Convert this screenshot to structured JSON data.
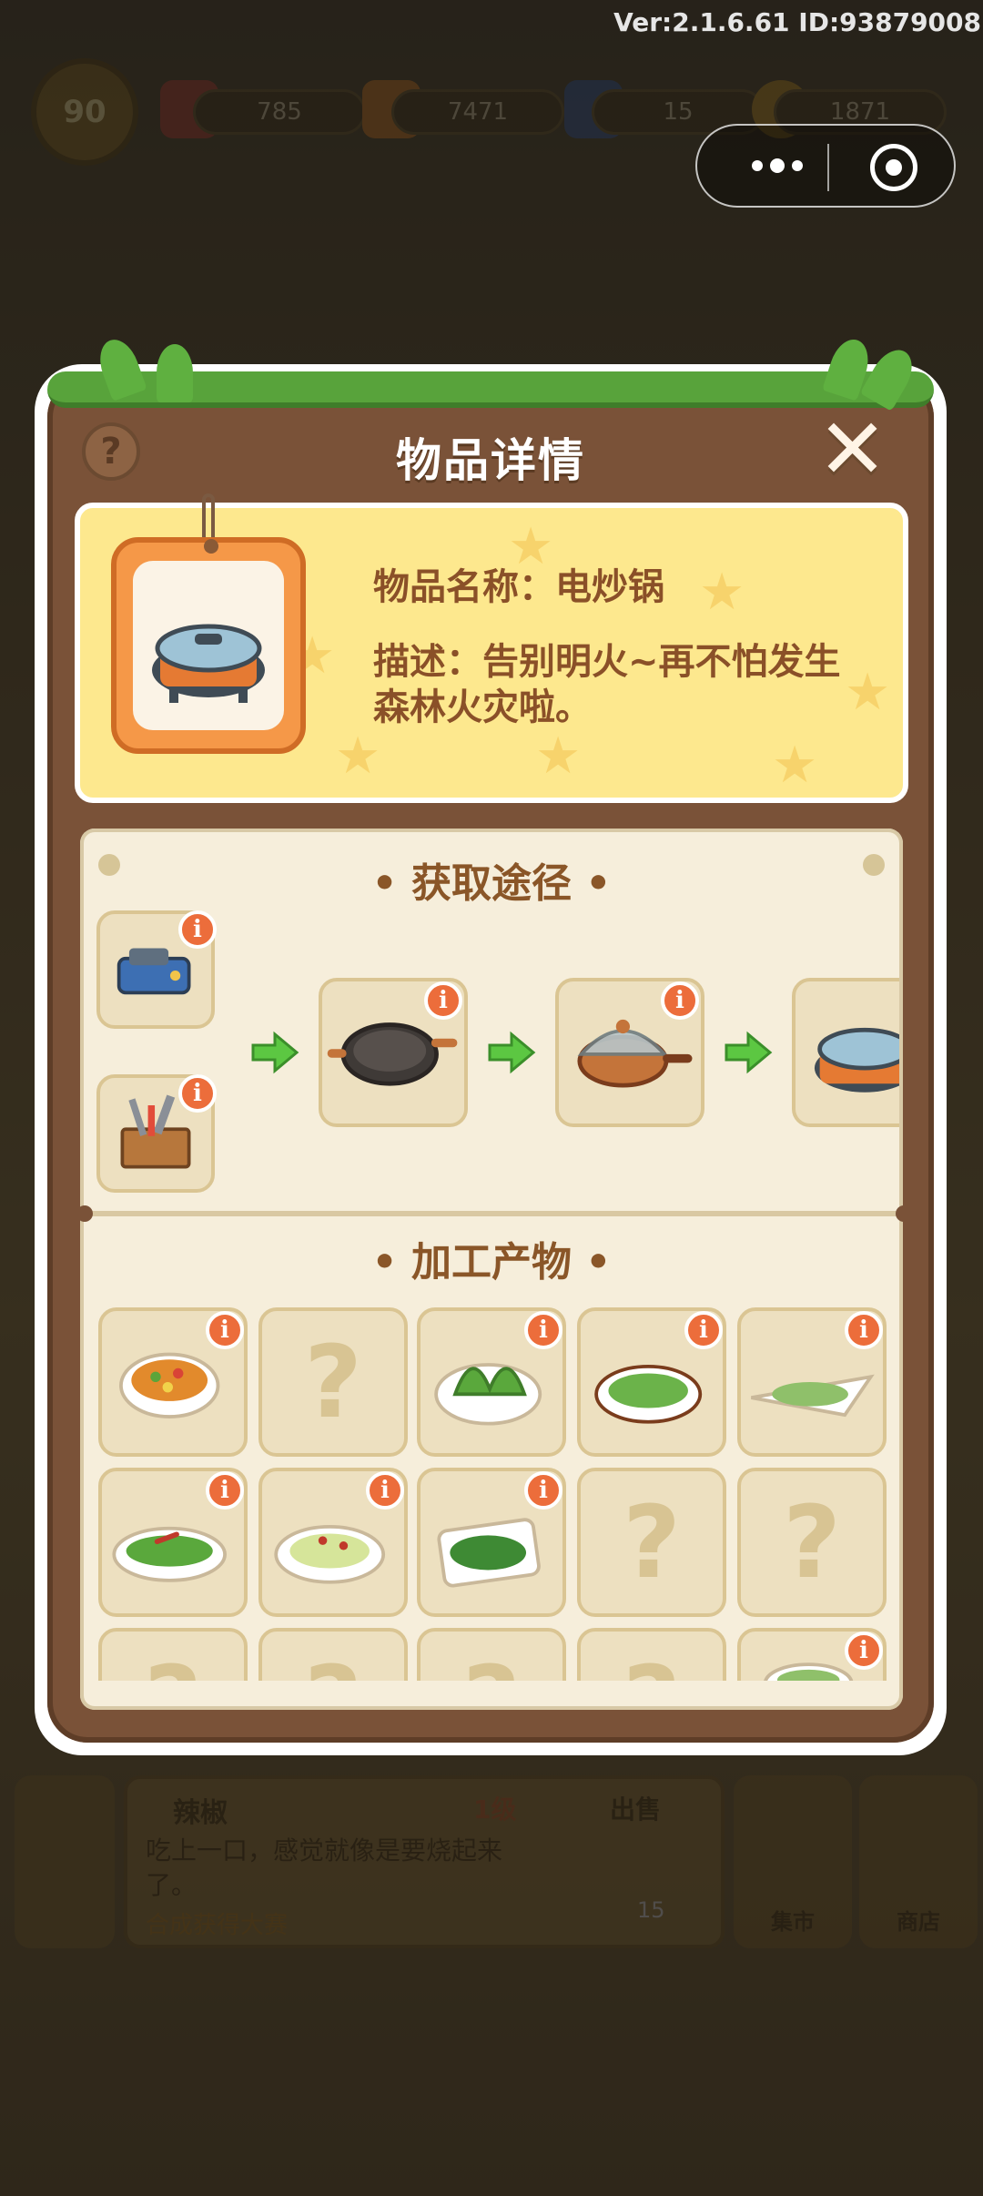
{
  "version_text": "Ver:2.1.6.61 ID:93879008",
  "hud": {
    "level": "90",
    "gems": "785",
    "carrots": "7471",
    "energy": "15",
    "coins": "1871"
  },
  "modal": {
    "title": "物品详情",
    "help_label": "?",
    "close_label": "✕",
    "item_name_line": "物品名称：电炒锅",
    "item_desc_line": "描述：告别明火~再不怕发生森林火灾啦。",
    "section_source_title": "• 获取途径 •",
    "section_products_title": "• 加工产物 •",
    "info_badge": "i",
    "unknown_mark": "?"
  },
  "bottom_bar": {
    "item_title": "辣椒",
    "item_level": "1级",
    "item_desc": "吃上一口，感觉就像是要烧起来了。",
    "item_hint": "合成获得大赛",
    "sell_label": "出售",
    "sell_price": "15",
    "market_label": "集市",
    "shop_label": "商店"
  },
  "colors": {
    "modal_brown": "#7a5238",
    "card_yellow": "#fde88e",
    "panel_cream": "#f6eedb",
    "accent_orange": "#ec6d3b",
    "text_brown": "#8a5028",
    "arrow_green": "#5cc742"
  }
}
